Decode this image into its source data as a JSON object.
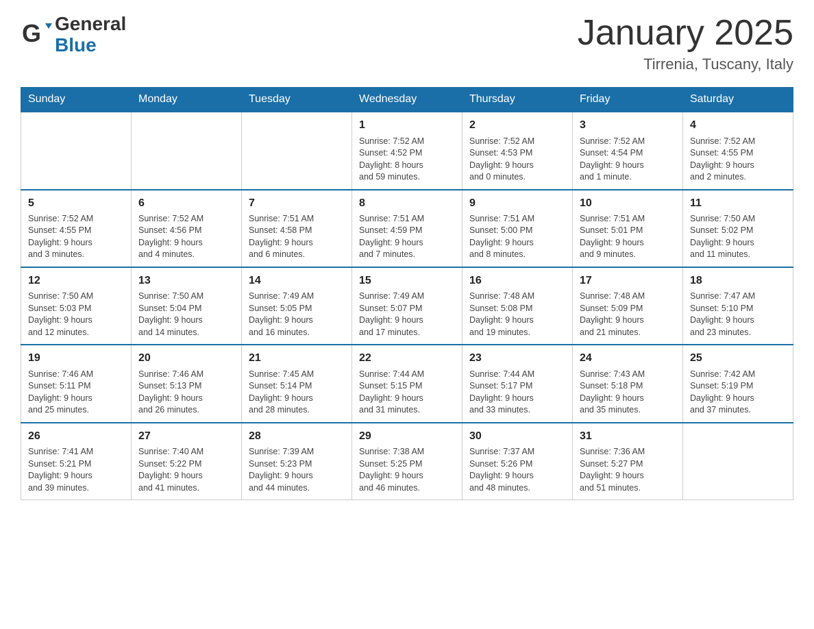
{
  "header": {
    "logo_line1": "General",
    "logo_line2": "Blue",
    "month_title": "January 2025",
    "location": "Tirrenia, Tuscany, Italy"
  },
  "days_of_week": [
    "Sunday",
    "Monday",
    "Tuesday",
    "Wednesday",
    "Thursday",
    "Friday",
    "Saturday"
  ],
  "weeks": [
    [
      {
        "day": "",
        "info": ""
      },
      {
        "day": "",
        "info": ""
      },
      {
        "day": "",
        "info": ""
      },
      {
        "day": "1",
        "info": "Sunrise: 7:52 AM\nSunset: 4:52 PM\nDaylight: 8 hours\nand 59 minutes."
      },
      {
        "day": "2",
        "info": "Sunrise: 7:52 AM\nSunset: 4:53 PM\nDaylight: 9 hours\nand 0 minutes."
      },
      {
        "day": "3",
        "info": "Sunrise: 7:52 AM\nSunset: 4:54 PM\nDaylight: 9 hours\nand 1 minute."
      },
      {
        "day": "4",
        "info": "Sunrise: 7:52 AM\nSunset: 4:55 PM\nDaylight: 9 hours\nand 2 minutes."
      }
    ],
    [
      {
        "day": "5",
        "info": "Sunrise: 7:52 AM\nSunset: 4:55 PM\nDaylight: 9 hours\nand 3 minutes."
      },
      {
        "day": "6",
        "info": "Sunrise: 7:52 AM\nSunset: 4:56 PM\nDaylight: 9 hours\nand 4 minutes."
      },
      {
        "day": "7",
        "info": "Sunrise: 7:51 AM\nSunset: 4:58 PM\nDaylight: 9 hours\nand 6 minutes."
      },
      {
        "day": "8",
        "info": "Sunrise: 7:51 AM\nSunset: 4:59 PM\nDaylight: 9 hours\nand 7 minutes."
      },
      {
        "day": "9",
        "info": "Sunrise: 7:51 AM\nSunset: 5:00 PM\nDaylight: 9 hours\nand 8 minutes."
      },
      {
        "day": "10",
        "info": "Sunrise: 7:51 AM\nSunset: 5:01 PM\nDaylight: 9 hours\nand 9 minutes."
      },
      {
        "day": "11",
        "info": "Sunrise: 7:50 AM\nSunset: 5:02 PM\nDaylight: 9 hours\nand 11 minutes."
      }
    ],
    [
      {
        "day": "12",
        "info": "Sunrise: 7:50 AM\nSunset: 5:03 PM\nDaylight: 9 hours\nand 12 minutes."
      },
      {
        "day": "13",
        "info": "Sunrise: 7:50 AM\nSunset: 5:04 PM\nDaylight: 9 hours\nand 14 minutes."
      },
      {
        "day": "14",
        "info": "Sunrise: 7:49 AM\nSunset: 5:05 PM\nDaylight: 9 hours\nand 16 minutes."
      },
      {
        "day": "15",
        "info": "Sunrise: 7:49 AM\nSunset: 5:07 PM\nDaylight: 9 hours\nand 17 minutes."
      },
      {
        "day": "16",
        "info": "Sunrise: 7:48 AM\nSunset: 5:08 PM\nDaylight: 9 hours\nand 19 minutes."
      },
      {
        "day": "17",
        "info": "Sunrise: 7:48 AM\nSunset: 5:09 PM\nDaylight: 9 hours\nand 21 minutes."
      },
      {
        "day": "18",
        "info": "Sunrise: 7:47 AM\nSunset: 5:10 PM\nDaylight: 9 hours\nand 23 minutes."
      }
    ],
    [
      {
        "day": "19",
        "info": "Sunrise: 7:46 AM\nSunset: 5:11 PM\nDaylight: 9 hours\nand 25 minutes."
      },
      {
        "day": "20",
        "info": "Sunrise: 7:46 AM\nSunset: 5:13 PM\nDaylight: 9 hours\nand 26 minutes."
      },
      {
        "day": "21",
        "info": "Sunrise: 7:45 AM\nSunset: 5:14 PM\nDaylight: 9 hours\nand 28 minutes."
      },
      {
        "day": "22",
        "info": "Sunrise: 7:44 AM\nSunset: 5:15 PM\nDaylight: 9 hours\nand 31 minutes."
      },
      {
        "day": "23",
        "info": "Sunrise: 7:44 AM\nSunset: 5:17 PM\nDaylight: 9 hours\nand 33 minutes."
      },
      {
        "day": "24",
        "info": "Sunrise: 7:43 AM\nSunset: 5:18 PM\nDaylight: 9 hours\nand 35 minutes."
      },
      {
        "day": "25",
        "info": "Sunrise: 7:42 AM\nSunset: 5:19 PM\nDaylight: 9 hours\nand 37 minutes."
      }
    ],
    [
      {
        "day": "26",
        "info": "Sunrise: 7:41 AM\nSunset: 5:21 PM\nDaylight: 9 hours\nand 39 minutes."
      },
      {
        "day": "27",
        "info": "Sunrise: 7:40 AM\nSunset: 5:22 PM\nDaylight: 9 hours\nand 41 minutes."
      },
      {
        "day": "28",
        "info": "Sunrise: 7:39 AM\nSunset: 5:23 PM\nDaylight: 9 hours\nand 44 minutes."
      },
      {
        "day": "29",
        "info": "Sunrise: 7:38 AM\nSunset: 5:25 PM\nDaylight: 9 hours\nand 46 minutes."
      },
      {
        "day": "30",
        "info": "Sunrise: 7:37 AM\nSunset: 5:26 PM\nDaylight: 9 hours\nand 48 minutes."
      },
      {
        "day": "31",
        "info": "Sunrise: 7:36 AM\nSunset: 5:27 PM\nDaylight: 9 hours\nand 51 minutes."
      },
      {
        "day": "",
        "info": ""
      }
    ]
  ]
}
